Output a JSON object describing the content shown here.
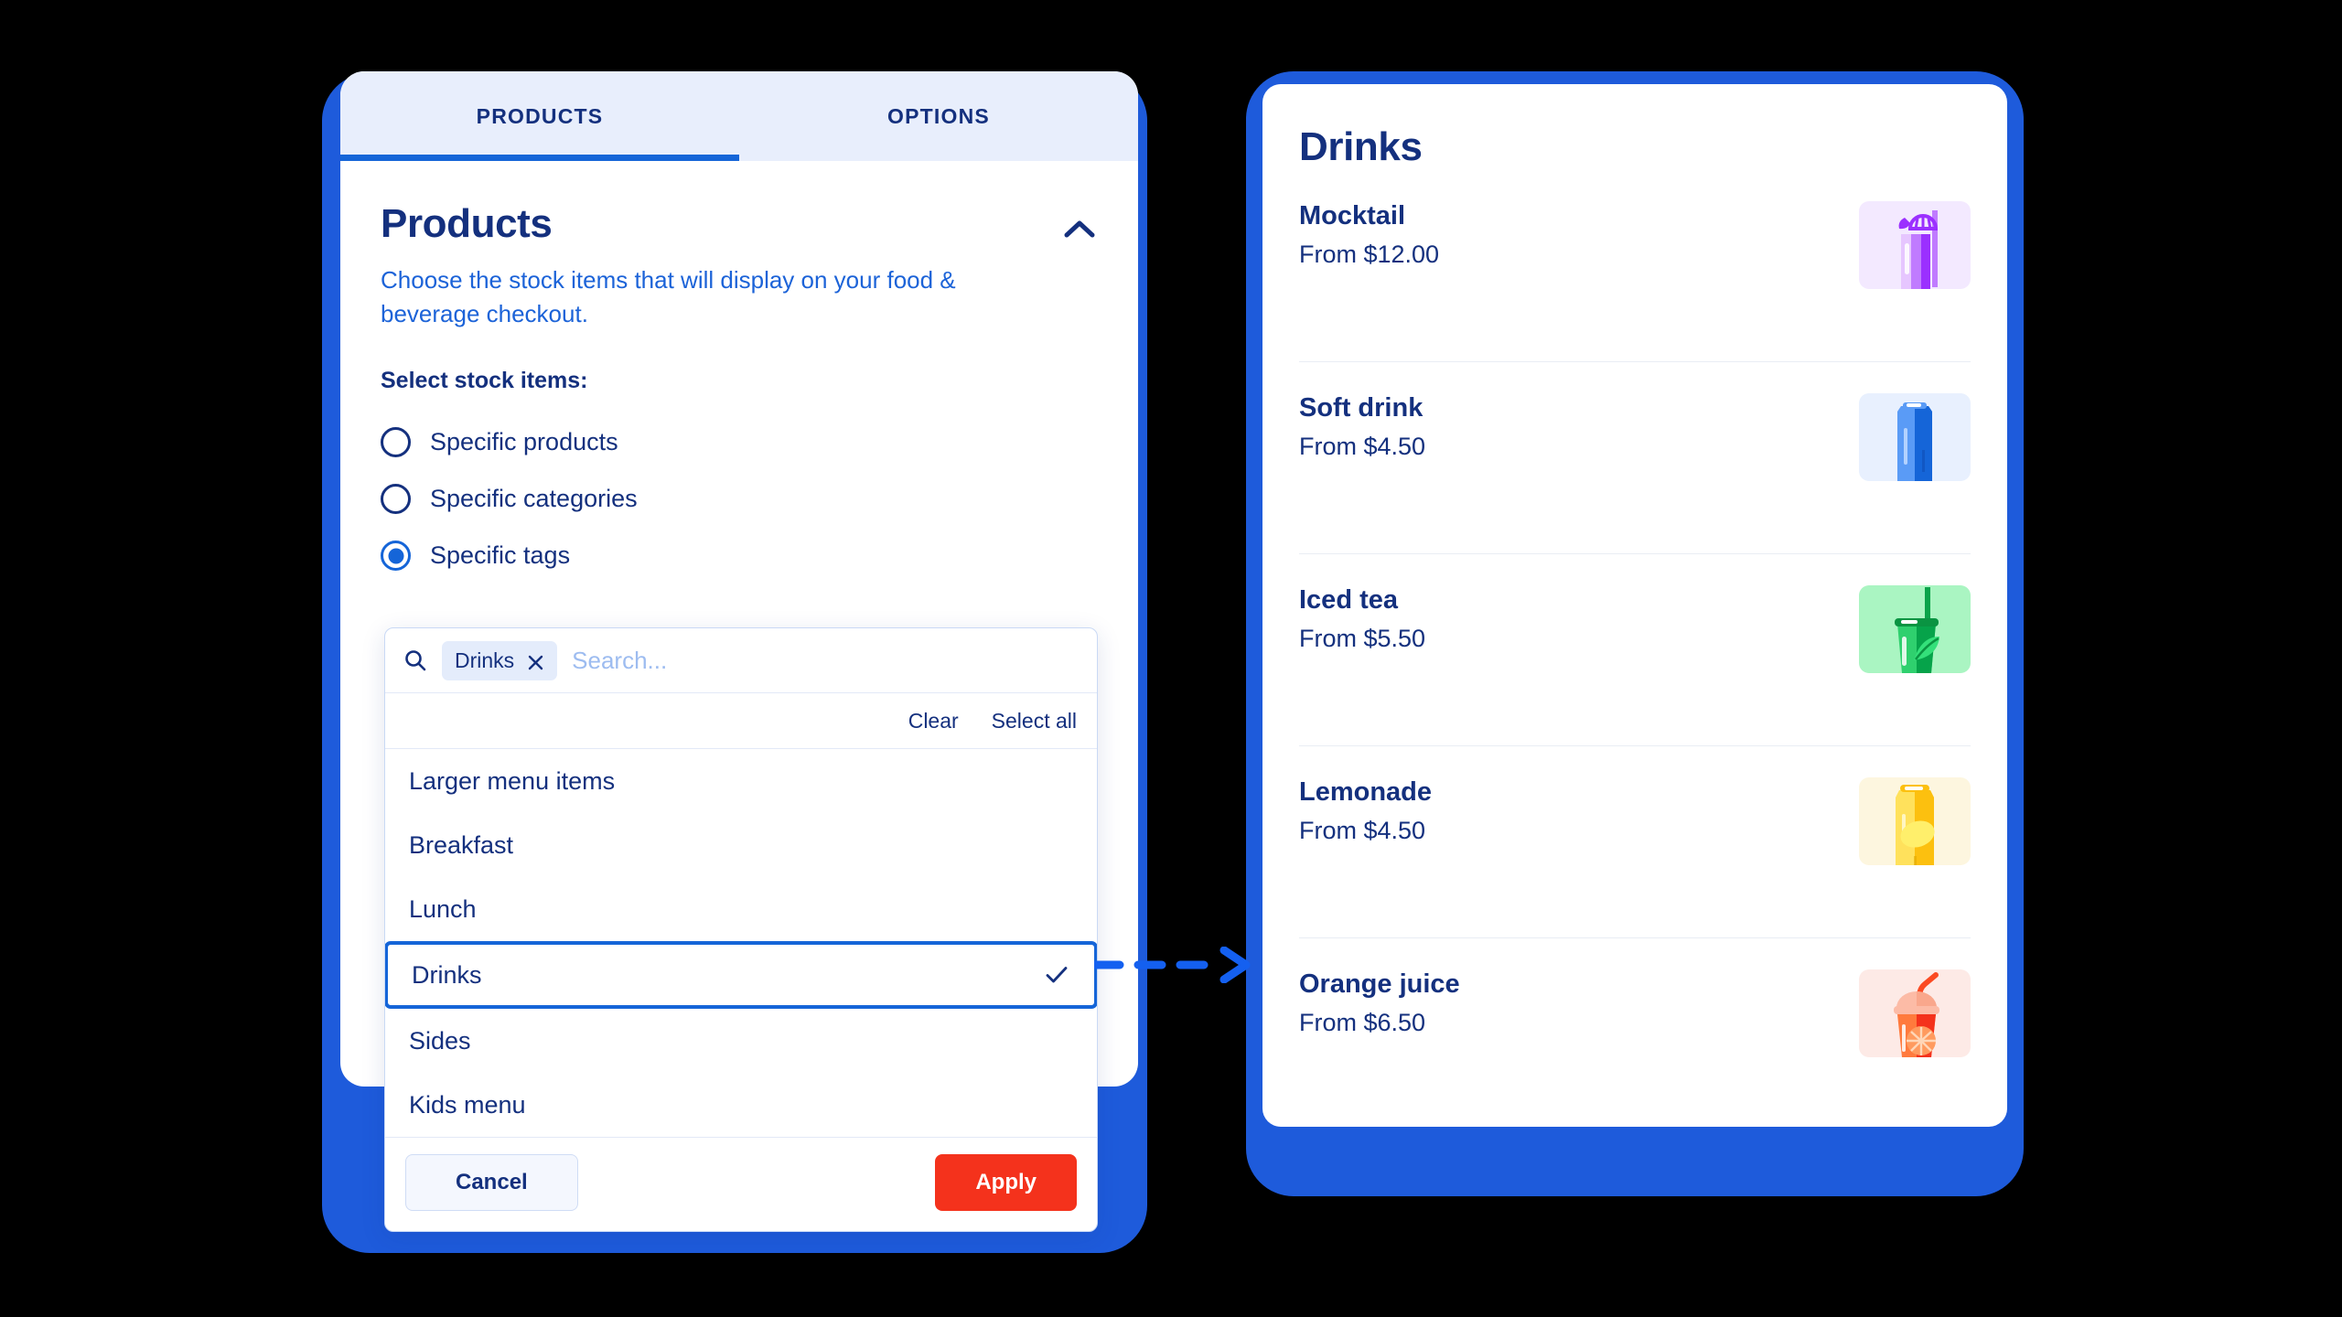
{
  "left_panel": {
    "tabs": [
      {
        "label": "PRODUCTS",
        "active": true
      },
      {
        "label": "OPTIONS",
        "active": false
      }
    ],
    "title": "Products",
    "description": "Choose the stock items that will display on your food & beverage checkout.",
    "collapse_icon": "chevron-up-icon",
    "section_label": "Select stock items:",
    "radio_options": [
      {
        "label": "Specific products",
        "selected": false
      },
      {
        "label": "Specific categories",
        "selected": false
      },
      {
        "label": "Specific tags",
        "selected": true
      }
    ]
  },
  "dropdown": {
    "search_icon": "search-icon",
    "chip": {
      "label": "Drinks",
      "remove_icon": "close-icon"
    },
    "search_placeholder": "Search...",
    "search_value": "",
    "clear_label": "Clear",
    "select_all_label": "Select all",
    "items": [
      {
        "label": "Larger menu items",
        "selected": false
      },
      {
        "label": "Breakfast",
        "selected": false
      },
      {
        "label": "Lunch",
        "selected": false
      },
      {
        "label": "Drinks",
        "selected": true
      },
      {
        "label": "Sides",
        "selected": false
      },
      {
        "label": "Kids menu",
        "selected": false
      }
    ],
    "check_icon": "check-icon",
    "cancel_label": "Cancel",
    "apply_label": "Apply"
  },
  "connector": {
    "icon": "dashed-arrow-right-icon"
  },
  "right_panel": {
    "title": "Drinks",
    "products": [
      {
        "name": "Mocktail",
        "price": "From $12.00",
        "icon": "mocktail-glass-icon",
        "thumb_bg": "#f3e9ff"
      },
      {
        "name": "Soft drink",
        "price": "From $4.50",
        "icon": "soda-can-icon",
        "thumb_bg": "#e8f0fe"
      },
      {
        "name": "Iced tea",
        "price": "From $5.50",
        "icon": "iced-tea-cup-icon",
        "thumb_bg": "#aaf5c2"
      },
      {
        "name": "Lemonade",
        "price": "From $4.50",
        "icon": "lemonade-can-icon",
        "thumb_bg": "#fdf6df"
      },
      {
        "name": "Orange juice",
        "price": "From $6.50",
        "icon": "orange-juice-cup-icon",
        "thumb_bg": "#fdeae6"
      }
    ]
  },
  "colors": {
    "frame_blue": "#1e5bdb",
    "accent_blue": "#1565d8",
    "navy_text": "#14307e",
    "apply_red": "#f4321c",
    "tab_bg": "#e8eefc"
  }
}
